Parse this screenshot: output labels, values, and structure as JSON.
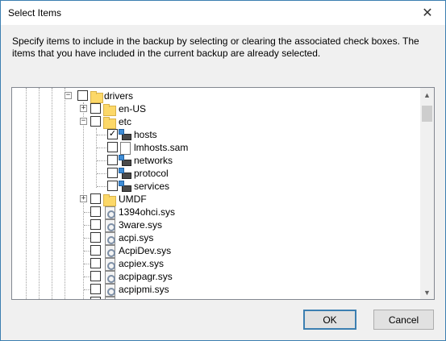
{
  "window": {
    "title": "Select Items"
  },
  "instruction": "Specify items to include in the backup by selecting or clearing the associated check boxes. The items that you have included in the current backup are already selected.",
  "tree": {
    "items": [
      {
        "label": "drivers",
        "icon": "folder-icon",
        "checked": false,
        "expander": "−"
      },
      {
        "label": "en-US",
        "icon": "folder-icon",
        "checked": false,
        "expander": "+"
      },
      {
        "label": "etc",
        "icon": "folder-icon",
        "checked": false,
        "expander": "−"
      },
      {
        "label": "hosts",
        "icon": "network-file-icon",
        "checked": true
      },
      {
        "label": "lmhosts.sam",
        "icon": "file-icon",
        "checked": false
      },
      {
        "label": "networks",
        "icon": "network-file-icon",
        "checked": false
      },
      {
        "label": "protocol",
        "icon": "network-file-icon",
        "checked": false
      },
      {
        "label": "services",
        "icon": "network-file-icon",
        "checked": false
      },
      {
        "label": "UMDF",
        "icon": "folder-icon",
        "checked": false,
        "expander": "+"
      },
      {
        "label": "1394ohci.sys",
        "icon": "system-file-icon",
        "checked": false
      },
      {
        "label": "3ware.sys",
        "icon": "system-file-icon",
        "checked": false
      },
      {
        "label": "acpi.sys",
        "icon": "system-file-icon",
        "checked": false
      },
      {
        "label": "AcpiDev.sys",
        "icon": "system-file-icon",
        "checked": false
      },
      {
        "label": "acpiex.sys",
        "icon": "system-file-icon",
        "checked": false
      },
      {
        "label": "acpipagr.sys",
        "icon": "system-file-icon",
        "checked": false
      },
      {
        "label": "acpipmi.sys",
        "icon": "system-file-icon",
        "checked": false
      }
    ]
  },
  "buttons": {
    "ok": "OK",
    "cancel": "Cancel"
  },
  "glyphs": {
    "close": "✕",
    "check": "✓",
    "scroll_up": "▲",
    "scroll_down": "▼"
  }
}
